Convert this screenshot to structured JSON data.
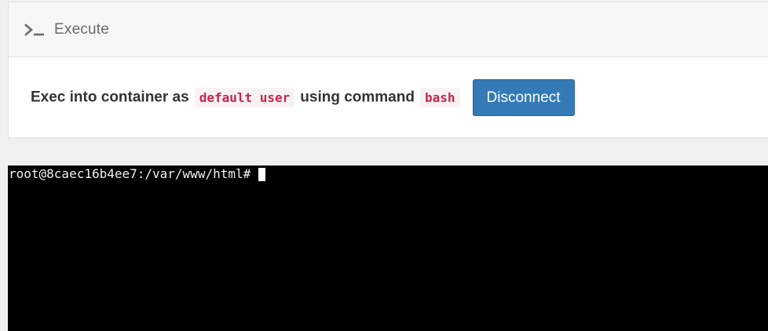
{
  "header": {
    "icon": "terminal-prompt-icon",
    "title": "Execute"
  },
  "exec": {
    "prefix": "Exec into container as",
    "user": "default user",
    "middle": "using command",
    "command": "bash",
    "disconnect_label": "Disconnect"
  },
  "terminal": {
    "prompt": "root@8caec16b4ee7:/var/www/html# "
  },
  "colors": {
    "primary_button": "#337ab7",
    "code_text": "#c7254e",
    "terminal_bg": "#000000"
  }
}
